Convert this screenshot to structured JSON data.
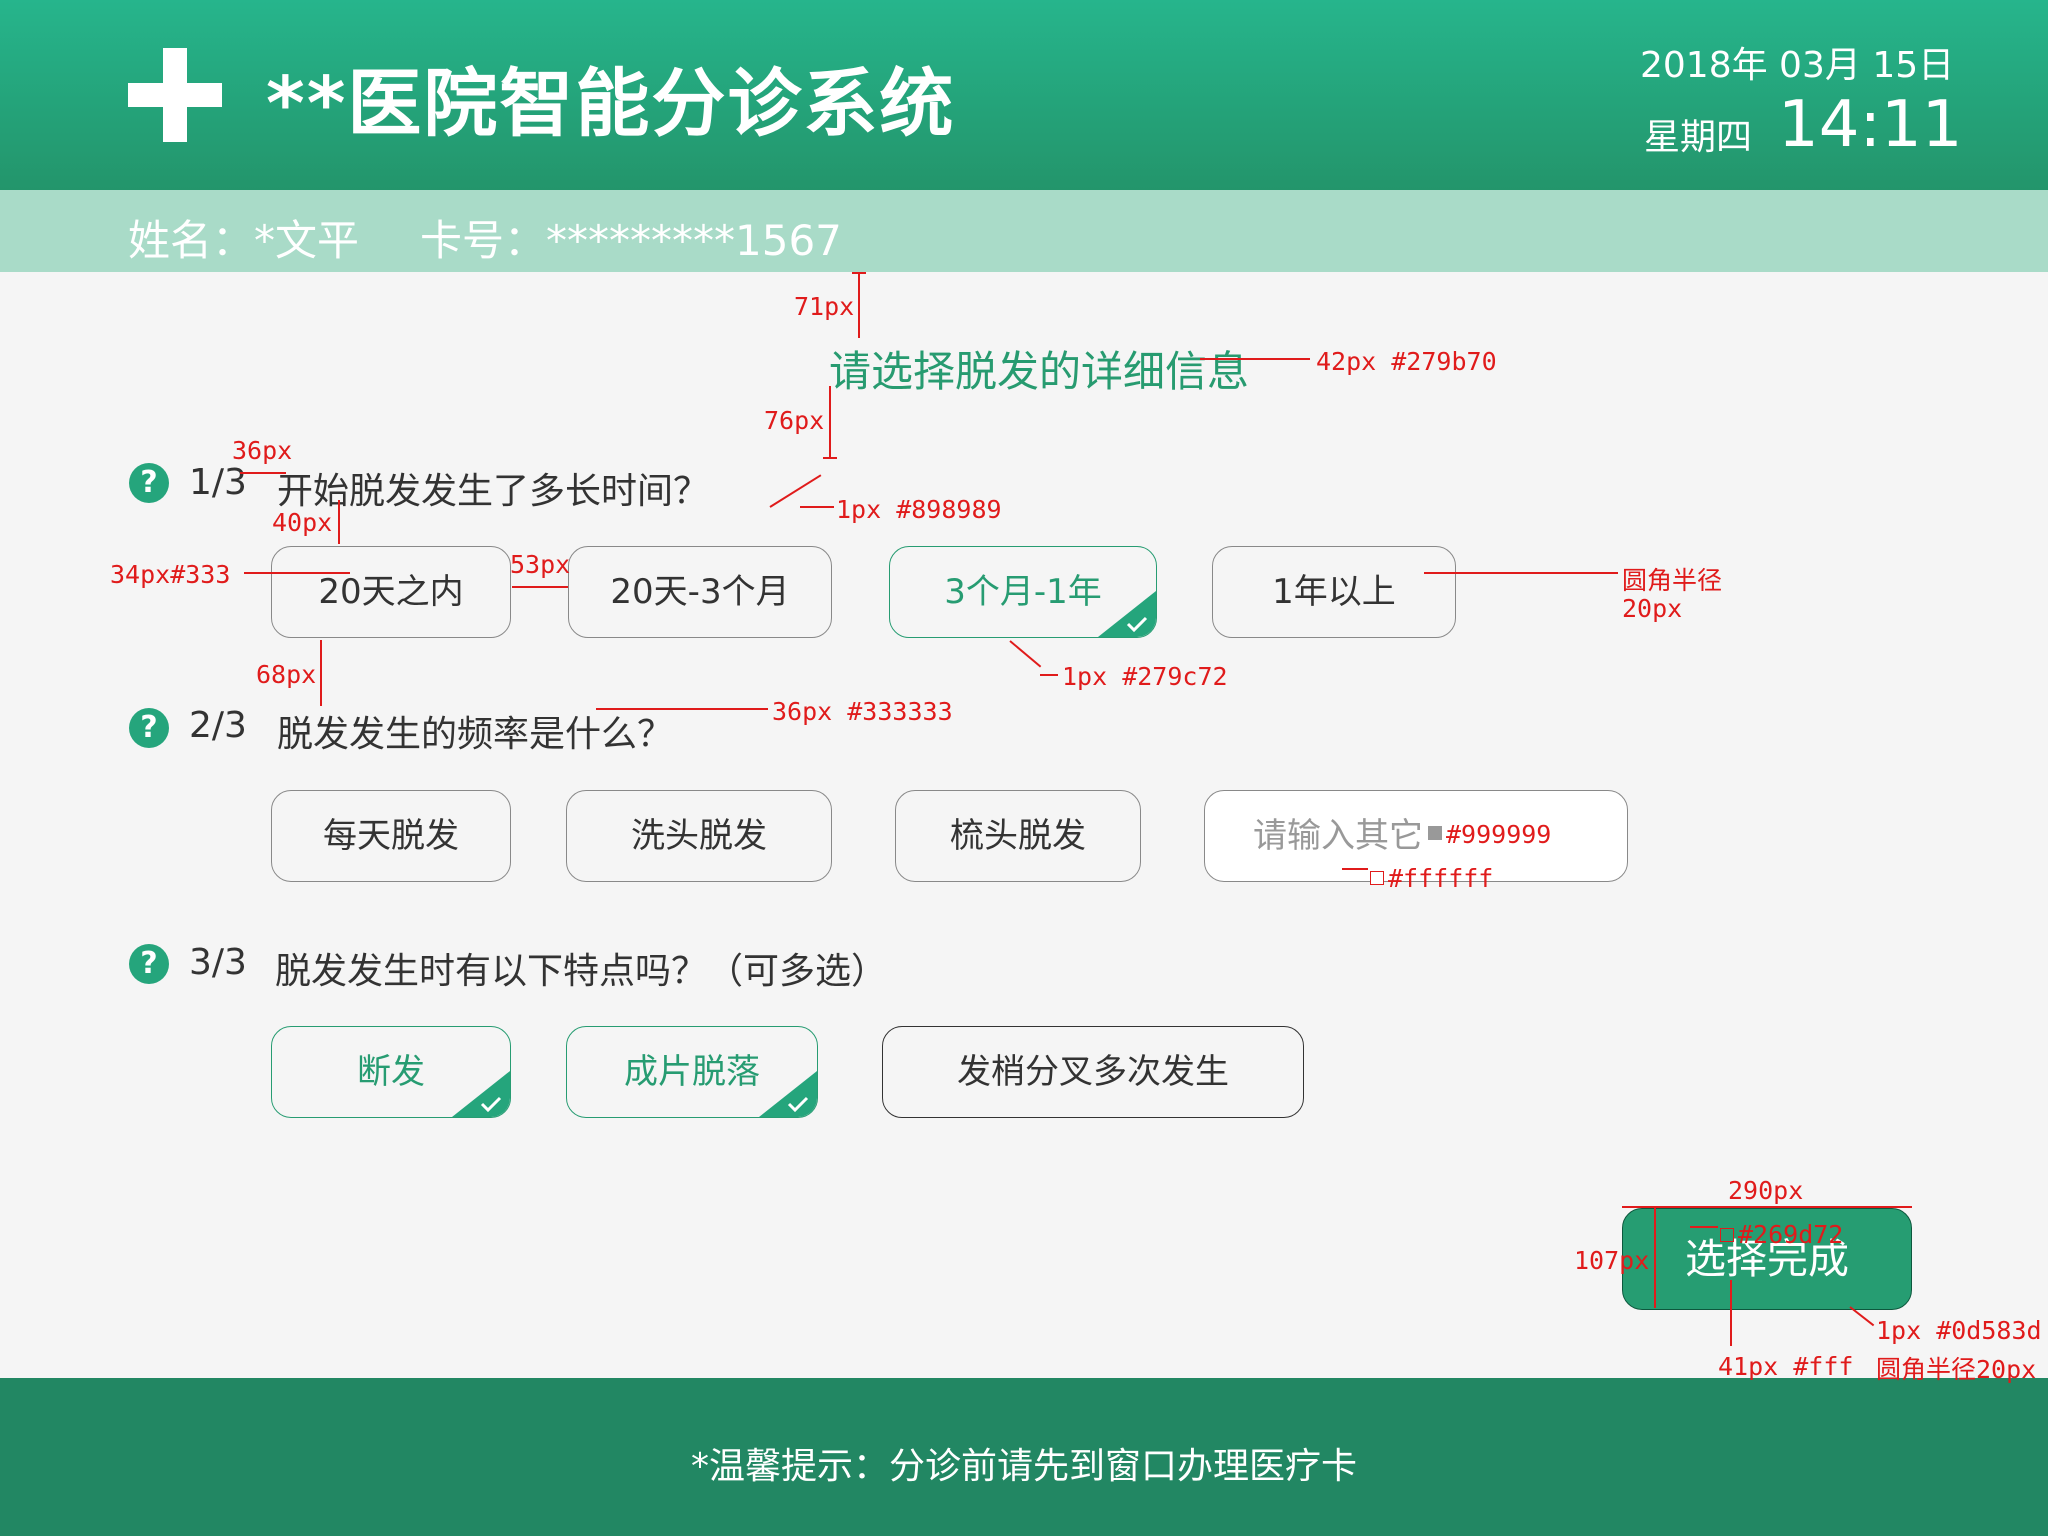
{
  "colors": {
    "primary": "#279b70",
    "selected_border": "#279c72",
    "submit_bg": "#269d72",
    "submit_border": "#0d583d",
    "text": "#333333",
    "placeholder": "#999999",
    "border": "#898989",
    "annotation": "#e01b1b"
  },
  "header": {
    "logo_icon": "plus-cross-icon",
    "title": "**医院智能分诊系统",
    "date": "2018年 03月 15日",
    "weekday": "星期四",
    "time": "14:11"
  },
  "patient": {
    "name": "姓名：*文平",
    "card": "卡号：*********1567"
  },
  "page_title": "请选择脱发的详细信息",
  "questions": [
    {
      "num": "1/3",
      "text": "开始脱发发生了多长时间？",
      "options": [
        {
          "label": "20天之内",
          "selected": false
        },
        {
          "label": "20天-3个月",
          "selected": false
        },
        {
          "label": "3个月-1年",
          "selected": true
        },
        {
          "label": "1年以上",
          "selected": false
        }
      ]
    },
    {
      "num": "2/3",
      "text": "脱发发生的频率是什么？",
      "options": [
        {
          "label": "每天脱发",
          "selected": false
        },
        {
          "label": "洗头脱发",
          "selected": false
        },
        {
          "label": "梳头脱发",
          "selected": false
        }
      ],
      "other_placeholder": "请输入其它"
    },
    {
      "num": "3/3",
      "text": "脱发发生时有以下特点吗？（可多选）",
      "options": [
        {
          "label": "断发",
          "selected": true
        },
        {
          "label": "成片脱落",
          "selected": true
        },
        {
          "label": "发梢分叉多次发生",
          "selected": false
        }
      ]
    }
  ],
  "submit_label": "选择完成",
  "footer_tip": "*温馨提示：分诊前请先到窗口办理医疗卡",
  "annotations": {
    "a71": "71px",
    "a42": "42px #279b70",
    "a76": "76px",
    "a36": "36px",
    "a40": "40px",
    "a1px898": "1px #898989",
    "a34": "34px#333",
    "a53": "53px",
    "radius": "圆角半径",
    "radius_val": "20px",
    "a1px279": "1px #279c72",
    "a68": "68px",
    "a36_333": "36px #333333",
    "a999": "#999999",
    "afff": "#ffffff",
    "a290": "290px",
    "a269": "#269d72",
    "a107": "107px",
    "a0d5": "1px #0d583d",
    "a41": "41px #fff",
    "radius2": "圆角半径20px"
  }
}
